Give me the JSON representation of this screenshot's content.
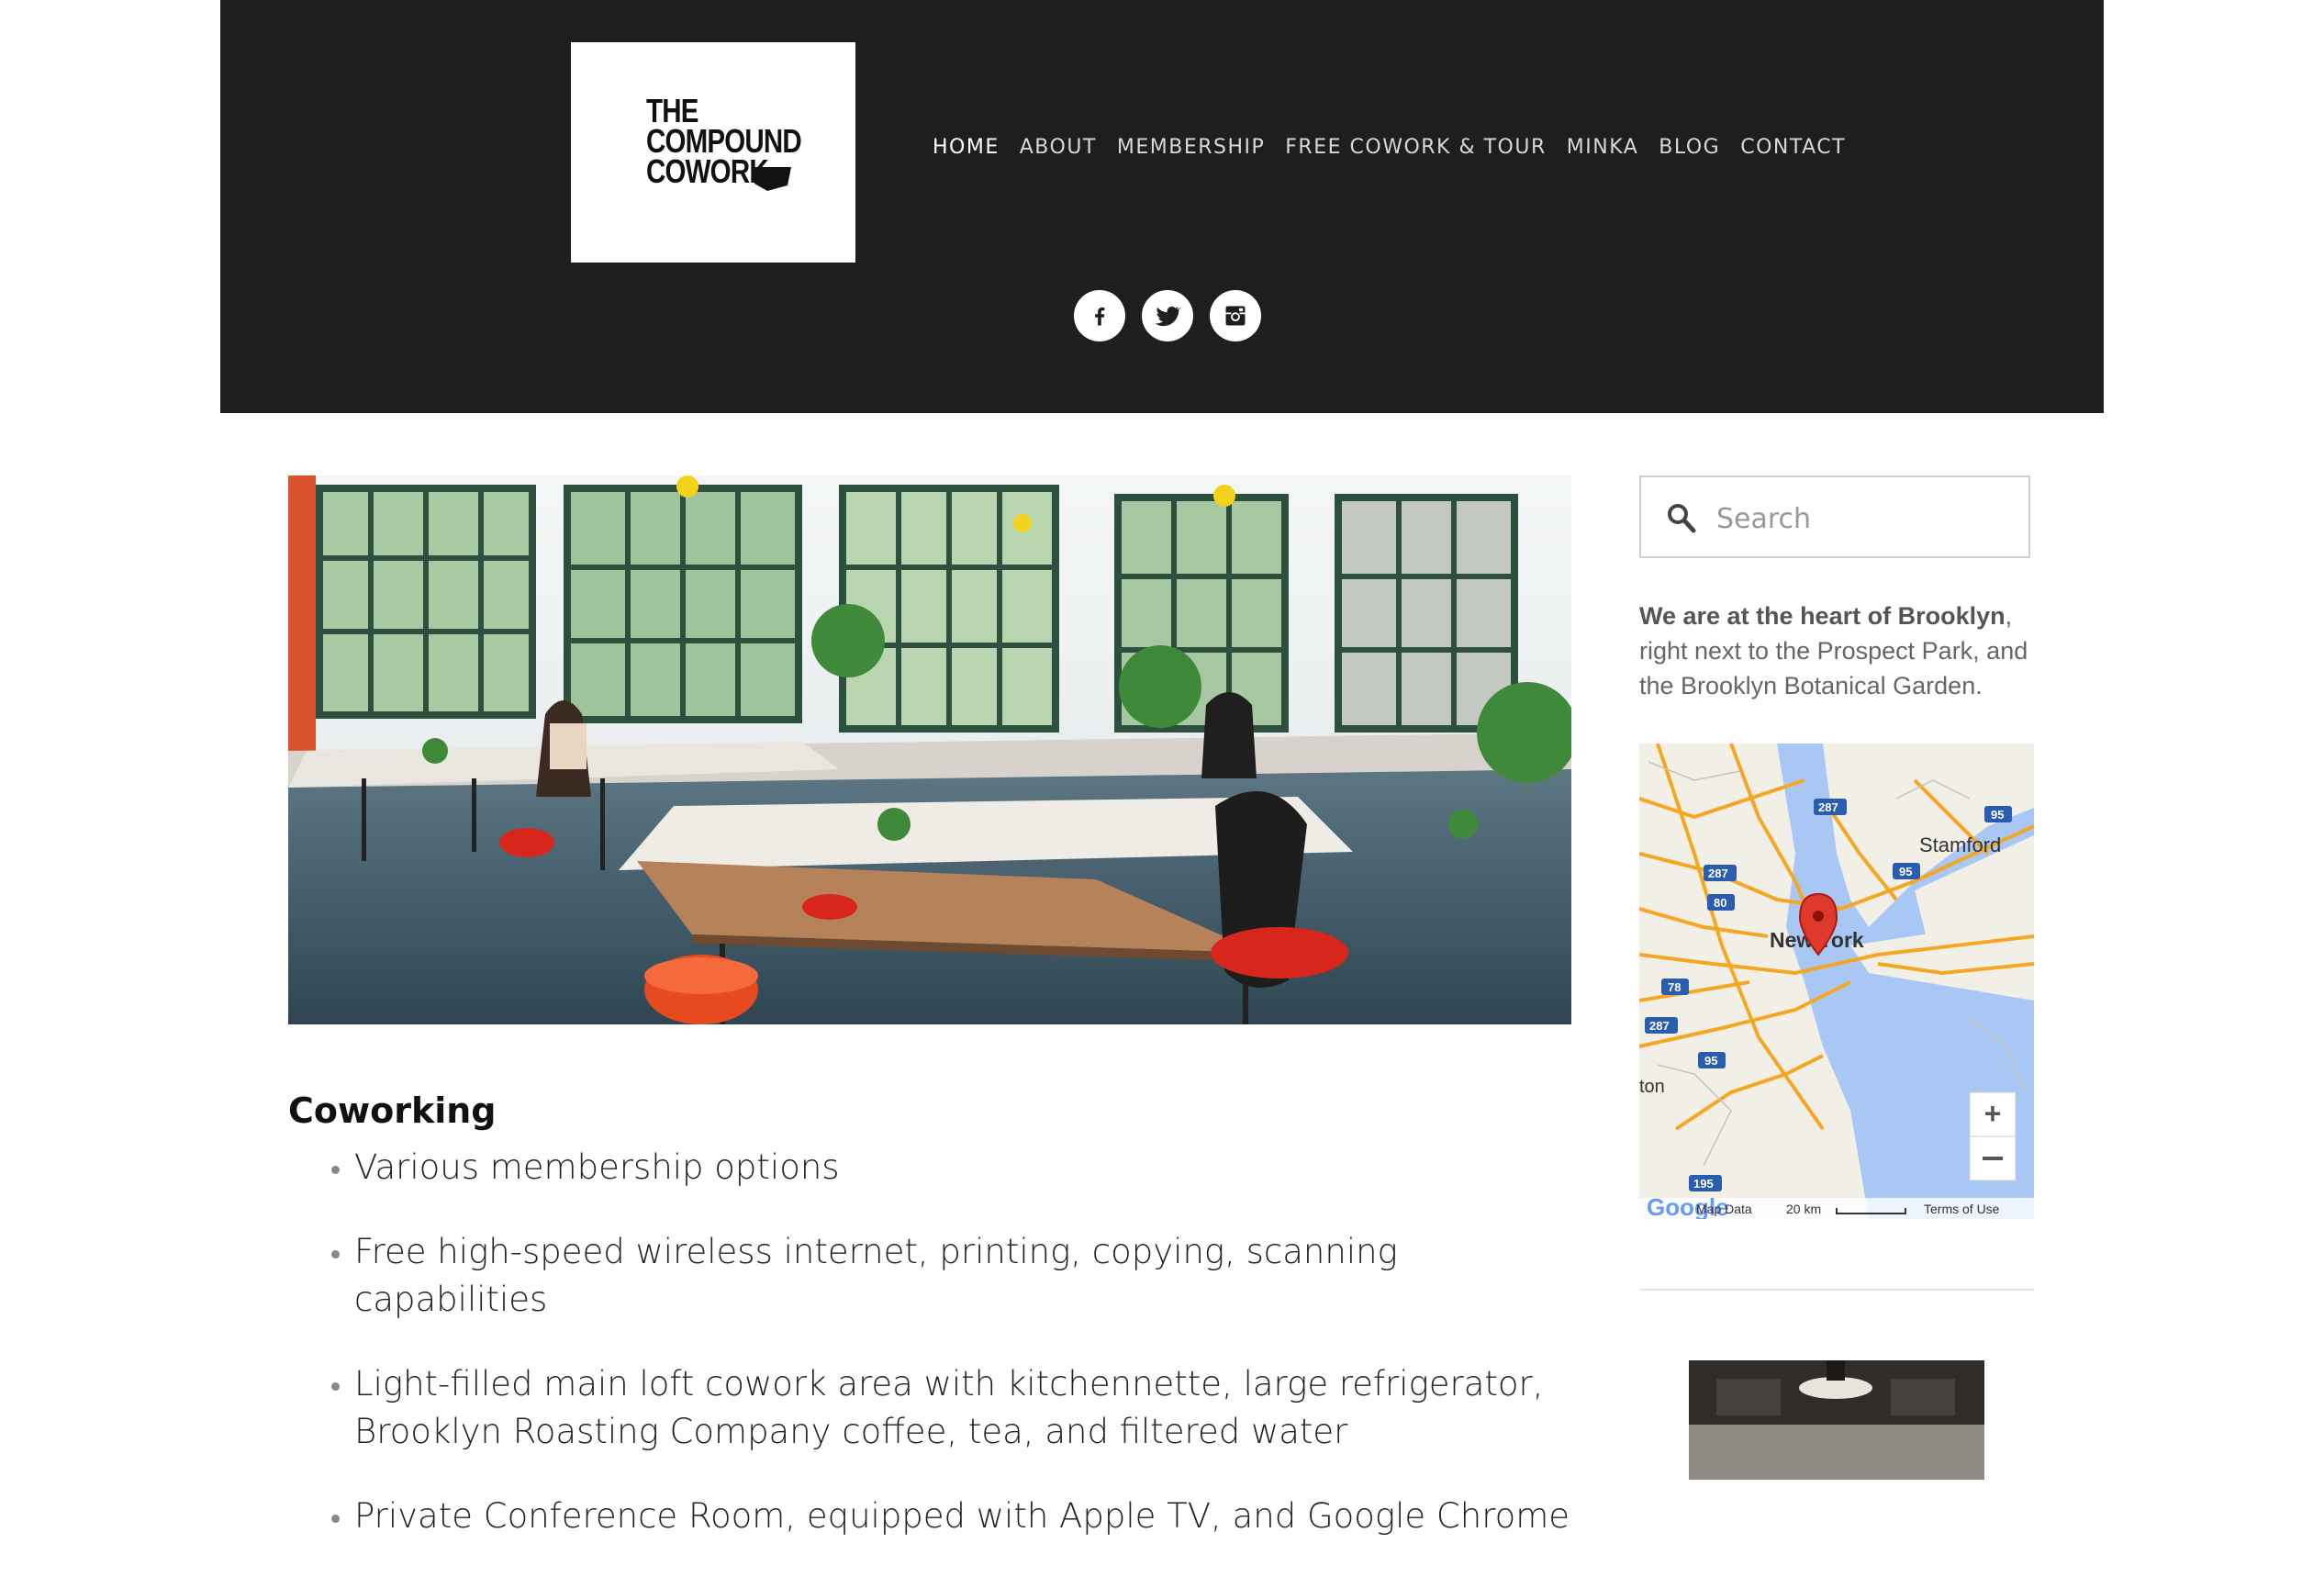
{
  "logo": {
    "lines": [
      "THE",
      "COMPOUND",
      "COWORK"
    ]
  },
  "nav": {
    "items": [
      {
        "label": "HOME",
        "active": true
      },
      {
        "label": "ABOUT"
      },
      {
        "label": "MEMBERSHIP"
      },
      {
        "label": "FREE COWORK & TOUR"
      },
      {
        "label": "MINKA"
      },
      {
        "label": "BLOG"
      },
      {
        "label": "CONTACT"
      }
    ]
  },
  "social": [
    "facebook-icon",
    "twitter-icon",
    "instagram-icon"
  ],
  "main": {
    "title": "Coworking",
    "bullets": [
      "Various membership options",
      "Free high-speed wireless internet, printing, copying, scanning capabilities",
      "Light-filled main loft cowork area with kitchennette, large refrigerator, Brooklyn Roasting Company coffee, tea, and filtered water",
      "Private Conference Room, equipped with Apple TV, and Google Chrome"
    ]
  },
  "sidebar": {
    "search_placeholder": "Search",
    "blurb_bold": "We are at the heart of Brooklyn",
    "blurb_rest": ", right next to the Prospect Park, and the Brooklyn Botanical Garden.",
    "map": {
      "labels": {
        "stamford": "Stamford",
        "newyork": "New York",
        "ton": "ton",
        "map_data": "Map Data",
        "scale": "20 km",
        "terms": "Terms of Use",
        "google": "Google"
      },
      "shields": [
        "287",
        "287",
        "80",
        "95",
        "95",
        "78",
        "287",
        "95",
        "195"
      ]
    }
  },
  "colors": {
    "header_bg": "#1e1e1e",
    "map_water": "#a8c7f5",
    "map_land": "#f2efe6",
    "roads": "#f5a623",
    "marker": "#e0392b"
  }
}
